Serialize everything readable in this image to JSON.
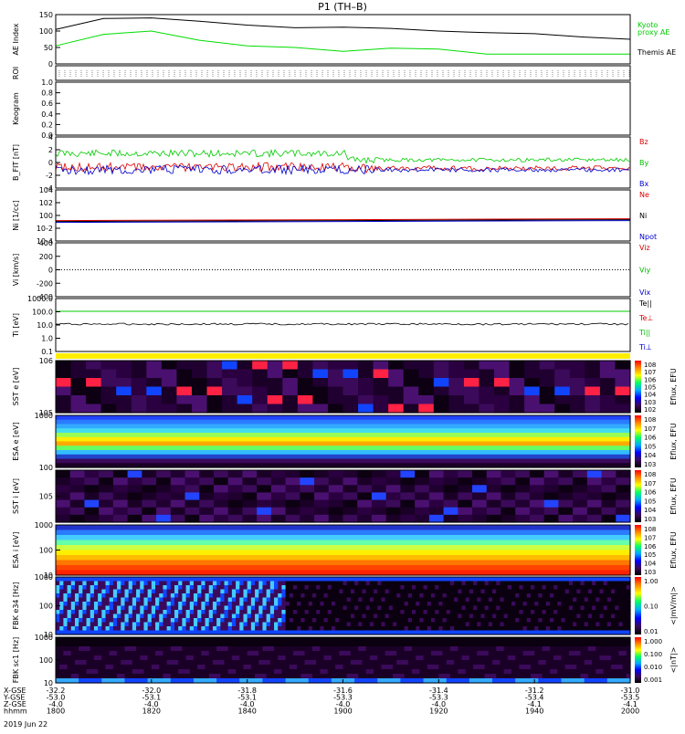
{
  "title": "P1  (TH–B)",
  "chart_data": {
    "type": "line",
    "title": "P1  (TH–B)",
    "date_label": "2019 Jun 22",
    "x_time_ticks": [
      "1800",
      "1820",
      "1840",
      "1900",
      "1920",
      "1940",
      "2000"
    ],
    "orbit_rows": [
      {
        "label": "X-GSE",
        "values": [
          "-32.2",
          "-32.0",
          "-31.8",
          "-31.6",
          "-31.4",
          "-31.2",
          "-31.0"
        ]
      },
      {
        "label": "Y-GSE",
        "values": [
          "-53.0",
          "-53.1",
          "-53.1",
          "-53.3",
          "-53.3",
          "-53.4",
          "-53.5"
        ]
      },
      {
        "label": "Z-GSE",
        "values": [
          "-4.0",
          "-4.0",
          "-4.0",
          "-4.0",
          "-4.0",
          "-4.1",
          "-4.1"
        ]
      },
      {
        "label": "hhmm",
        "values": [
          "1800",
          "1820",
          "1840",
          "1900",
          "1920",
          "1940",
          "2000"
        ]
      }
    ],
    "panels": [
      {
        "id": "ae",
        "ylabel": "AE Index",
        "yticks": [
          "150",
          "100",
          "50",
          "0"
        ],
        "ylim": [
          0,
          150
        ],
        "legend": [
          "Kyoto proxy AE",
          "Themis AE"
        ],
        "series": [
          {
            "name": "Themis AE",
            "color": "#000000",
            "x": [
              0,
              10,
              20,
              30,
              40,
              50,
              60,
              70,
              80,
              90,
              100,
              110,
              120
            ],
            "y": [
              105,
              138,
              140,
              130,
              118,
              110,
              112,
              108,
              100,
              95,
              92,
              82,
              75
            ]
          },
          {
            "name": "Kyoto proxy AE",
            "color": "#00dd00",
            "x": [
              0,
              10,
              20,
              30,
              40,
              50,
              60,
              70,
              80,
              90,
              100,
              110,
              120
            ],
            "y": [
              55,
              90,
              100,
              72,
              55,
              50,
              38,
              48,
              45,
              30,
              30,
              30,
              30
            ]
          }
        ]
      },
      {
        "id": "roi",
        "ylabel": "ROI",
        "yticks": []
      },
      {
        "id": "keogram",
        "ylabel": "Keogram",
        "yticks": [
          "1.0",
          "0.8",
          "0.6",
          "0.4",
          "0.2",
          "0.0"
        ]
      },
      {
        "id": "bfit",
        "ylabel": "B_FIT [nT]",
        "yticks": [
          "4",
          "2",
          "0",
          "-2",
          "-4"
        ],
        "legend": [
          "Bz",
          "By",
          "Bx"
        ],
        "legend_colors": [
          "#dd0000",
          "#00bb00",
          "#0000cc"
        ]
      },
      {
        "id": "ni",
        "ylabel": "Ni [1/cc]",
        "yticks": [
          "10^4",
          "10^2",
          "10^0",
          "10^-2",
          "10^-4"
        ],
        "legend": [
          "Ne",
          "Ni",
          "Npot"
        ],
        "legend_colors": [
          "#dd0000",
          "#000000",
          "#0000cc"
        ]
      },
      {
        "id": "vi",
        "ylabel": "Vi [km/s]",
        "yticks": [
          "400",
          "200",
          "0",
          "-200",
          "-400"
        ],
        "legend": [
          "Viz",
          "Viy",
          "Vix"
        ],
        "legend_colors": [
          "#dd0000",
          "#00bb00",
          "#0000cc"
        ]
      },
      {
        "id": "ti",
        "ylabel": "Ti [eV]",
        "yticks": [
          "1000.0",
          "100.0",
          "10.0",
          "1.0",
          "0.1"
        ],
        "legend": [
          "Te||",
          "Te⊥",
          "Ti||",
          "Ti⊥"
        ],
        "legend_colors": [
          "#000000",
          "#dd0000",
          "#00bb00",
          "#0000cc"
        ]
      },
      {
        "id": "sst_e",
        "ylabel": "SST e [eV]",
        "yticks": [
          "10^6",
          "10^5"
        ],
        "colorbar_ticks": [
          "10^8",
          "10^7",
          "10^6",
          "10^5",
          "10^4",
          "10^3",
          "10^2"
        ],
        "colorbar_label": "Eflux, EFU"
      },
      {
        "id": "esa_e",
        "ylabel": "ESA e [eV]",
        "yticks": [
          "1000",
          "100"
        ],
        "colorbar_ticks": [
          "10^8",
          "10^7",
          "10^6",
          "10^5",
          "10^4",
          "10^3"
        ],
        "colorbar_label": "Eflux, EFU"
      },
      {
        "id": "sst_i",
        "ylabel": "SST i [eV]",
        "yticks": [
          "10^5"
        ],
        "colorbar_ticks": [
          "10^8",
          "10^7",
          "10^6",
          "10^5",
          "10^4",
          "10^3"
        ],
        "colorbar_label": "Eflux, EFU"
      },
      {
        "id": "esa_i",
        "ylabel": "ESA i [eV]",
        "yticks": [
          "1000",
          "100",
          "10"
        ],
        "colorbar_ticks": [
          "10^8",
          "10^7",
          "10^6",
          "10^5",
          "10^4",
          "10^3"
        ],
        "colorbar_label": "Eflux, EFU"
      },
      {
        "id": "fbk_e",
        "ylabel": "FBK e34 [Hz]",
        "yticks": [
          "1000",
          "100",
          "10"
        ],
        "colorbar_ticks": [
          "1.00",
          "0.10",
          "0.01"
        ],
        "colorbar_label": "<|mV/m|>"
      },
      {
        "id": "fbk_b",
        "ylabel": "FBK sc1 [Hz]",
        "yticks": [
          "1000",
          "100",
          "10"
        ],
        "colorbar_ticks": [
          "1.000",
          "0.100",
          "0.010",
          "0.001"
        ],
        "colorbar_label": "<|nT|>"
      }
    ]
  }
}
